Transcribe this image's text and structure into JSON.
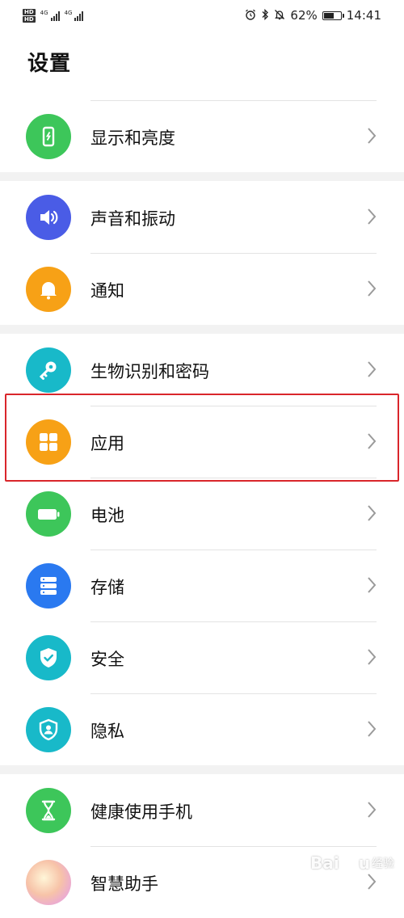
{
  "status_bar": {
    "hd1": "HD",
    "hd2": "HD",
    "net1": "4G",
    "net2": "4G",
    "battery_text": "62%",
    "battery_level": 0.62,
    "time": "14:41",
    "icons": [
      "alarm-icon",
      "bluetooth-icon",
      "mute-icon"
    ]
  },
  "page_title": "设置",
  "groups": [
    {
      "items": [
        {
          "label": "显示和亮度",
          "icon": "display-icon",
          "color": "#3dc65a"
        }
      ]
    },
    {
      "items": [
        {
          "label": "声音和振动",
          "icon": "sound-icon",
          "color": "#4a5ce6"
        },
        {
          "label": "通知",
          "icon": "bell-icon",
          "color": "#f7a116"
        }
      ]
    },
    {
      "items": [
        {
          "label": "生物识别和密码",
          "icon": "key-icon",
          "color": "#18b9c9"
        },
        {
          "label": "应用",
          "icon": "apps-grid-icon",
          "color": "#f7a116"
        },
        {
          "label": "电池",
          "icon": "battery-icon",
          "color": "#3dc65a"
        },
        {
          "label": "存储",
          "icon": "storage-icon",
          "color": "#2a79f0"
        },
        {
          "label": "安全",
          "icon": "shield-check-icon",
          "color": "#18b9c9"
        },
        {
          "label": "隐私",
          "icon": "privacy-icon",
          "color": "#18b9c9"
        }
      ]
    },
    {
      "items": [
        {
          "label": "健康使用手机",
          "icon": "hourglass-icon",
          "color": "#3dc65a"
        },
        {
          "label": "智慧助手",
          "icon": "assistant-icon",
          "color": "#f2b8c6"
        }
      ]
    }
  ],
  "watermark": {
    "brand": "Bai",
    "brand_end": "u",
    "sub": "经验"
  }
}
